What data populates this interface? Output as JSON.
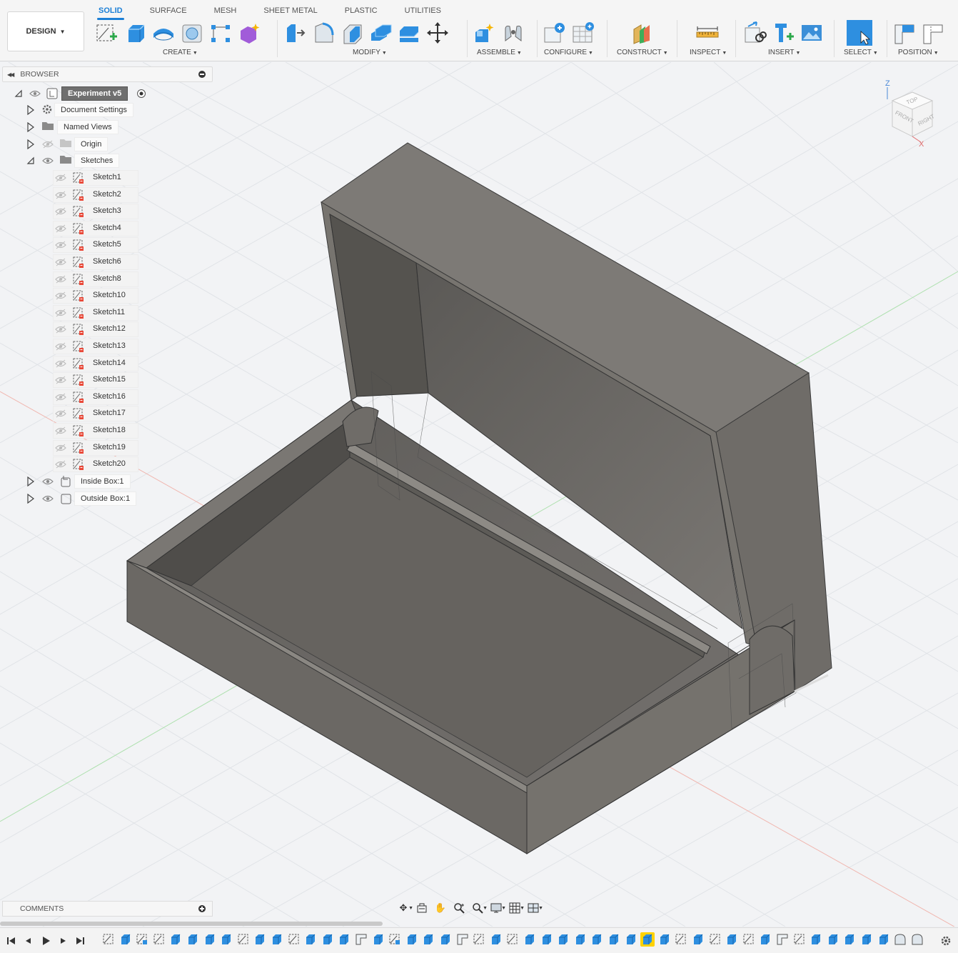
{
  "workspace": {
    "label": "DESIGN"
  },
  "tabs": [
    {
      "label": "SOLID",
      "active": true
    },
    {
      "label": "SURFACE",
      "active": false
    },
    {
      "label": "MESH",
      "active": false
    },
    {
      "label": "SHEET METAL",
      "active": false
    },
    {
      "label": "PLASTIC",
      "active": false
    },
    {
      "label": "UTILITIES",
      "active": false
    }
  ],
  "groups": {
    "create": "CREATE",
    "modify": "MODIFY",
    "assemble": "ASSEMBLE",
    "configure": "CONFIGURE",
    "construct": "CONSTRUCT",
    "inspect": "INSPECT",
    "insert": "INSERT",
    "select": "SELECT",
    "position": "POSITION"
  },
  "browser": {
    "title": "BROWSER",
    "root": "Experiment v5",
    "document_settings": "Document Settings",
    "named_views": "Named Views",
    "origin": "Origin",
    "sketches": "Sketches",
    "sketch_items": [
      "Sketch1",
      "Sketch2",
      "Sketch3",
      "Sketch4",
      "Sketch5",
      "Sketch6",
      "Sketch8",
      "Sketch10",
      "Sketch11",
      "Sketch12",
      "Sketch13",
      "Sketch14",
      "Sketch15",
      "Sketch16",
      "Sketch17",
      "Sketch18",
      "Sketch19",
      "Sketch20"
    ],
    "components": [
      "Inside Box:1",
      "Outside Box:1"
    ]
  },
  "comments": {
    "title": "COMMENTS"
  },
  "viewcube": {
    "top": "TOP",
    "front": "FRONT",
    "right": "RIGHT",
    "axis_z": "Z",
    "axis_x": "X"
  },
  "colors": {
    "accent": "#1b7fd6",
    "model": "#706d68",
    "timeline_selected": "#ffd200"
  }
}
